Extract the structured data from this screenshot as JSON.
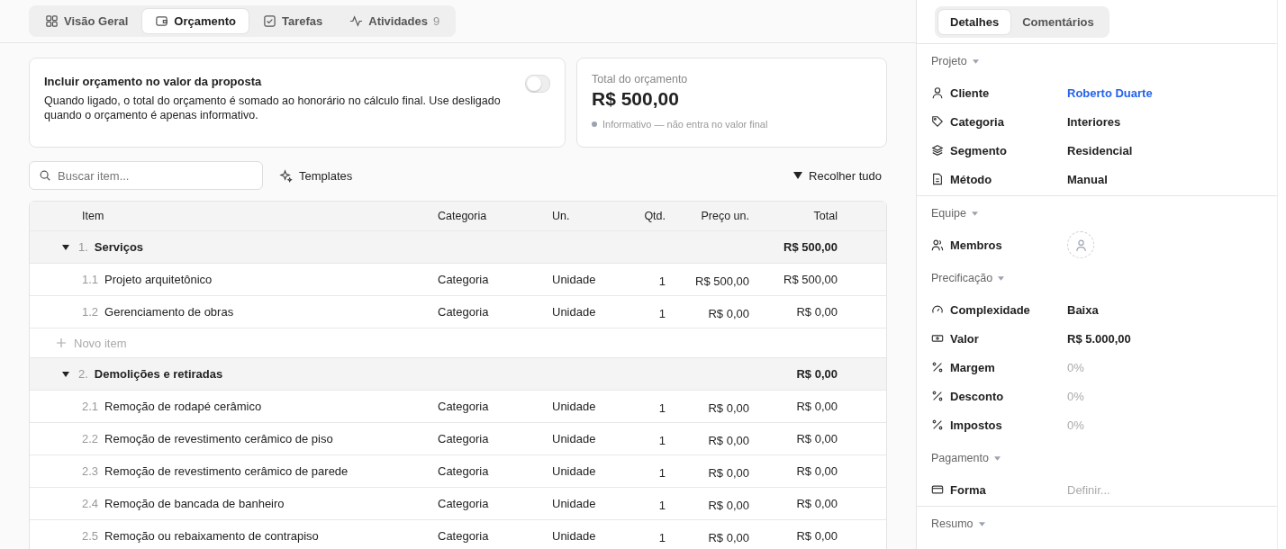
{
  "tabs": [
    {
      "label": "Visão Geral",
      "selected": false
    },
    {
      "label": "Orçamento",
      "selected": true
    },
    {
      "label": "Tarefas",
      "selected": false
    },
    {
      "label": "Atividades",
      "count": "9",
      "selected": false
    }
  ],
  "include_card": {
    "title": "Incluir orçamento no valor da proposta",
    "description": "Quando ligado, o total do orçamento é somado ao honorário no cálculo final. Use desligado quando o orçamento é apenas informativo.",
    "on": false
  },
  "total_card": {
    "label": "Total do orçamento",
    "value": "R$ 500,00",
    "note": "Informativo — não entra no valor final"
  },
  "toolbar": {
    "search": {
      "placeholder": "Buscar item..."
    },
    "templates": "Templates",
    "collapse": "Recolher tudo"
  },
  "table": {
    "columns": [
      "Item",
      "Categoria",
      "Un.",
      "Qtd.",
      "Preço un.",
      "Total"
    ],
    "groups": [
      {
        "number": "1.",
        "name": "Serviços",
        "total": "R$ 500,00",
        "expanded": true,
        "add_label": "Novo item",
        "children": [
          {
            "number": "1.1",
            "name": "Projeto arquitetônico",
            "category": "Categoria",
            "unit": "Unidade",
            "qty": "1",
            "price": "R$ 500,00",
            "total": "R$ 500,00"
          },
          {
            "number": "1.2",
            "name": "Gerenciamento de obras",
            "category": "Categoria",
            "unit": "Unidade",
            "qty": "1",
            "price": "R$ 0,00",
            "total": "R$ 0,00"
          }
        ]
      },
      {
        "number": "2.",
        "name": "Demolições e retiradas",
        "total": "R$ 0,00",
        "expanded": true,
        "children": [
          {
            "number": "2.1",
            "name": "Remoção de rodapé cerâmico",
            "category": "Categoria",
            "unit": "Unidade",
            "qty": "1",
            "price": "R$ 0,00",
            "total": "R$ 0,00"
          },
          {
            "number": "2.2",
            "name": "Remoção de revestimento cerâmico de piso",
            "category": "Categoria",
            "unit": "Unidade",
            "qty": "1",
            "price": "R$ 0,00",
            "total": "R$ 0,00"
          },
          {
            "number": "2.3",
            "name": "Remoção de revestimento cerâmico de parede",
            "category": "Categoria",
            "unit": "Unidade",
            "qty": "1",
            "price": "R$ 0,00",
            "total": "R$ 0,00"
          },
          {
            "number": "2.4",
            "name": "Remoção de bancada de banheiro",
            "category": "Categoria",
            "unit": "Unidade",
            "qty": "1",
            "price": "R$ 0,00",
            "total": "R$ 0,00"
          },
          {
            "number": "2.5",
            "name": "Remoção ou rebaixamento de contrapiso",
            "category": "Categoria",
            "unit": "Unidade",
            "qty": "1",
            "price": "R$ 0,00",
            "total": "R$ 0,00"
          }
        ]
      }
    ]
  },
  "sidebar": {
    "tabs": [
      {
        "label": "Detalhes",
        "selected": true
      },
      {
        "label": "Comentários",
        "selected": false
      }
    ],
    "sections": [
      {
        "title": "Projeto",
        "divider": true,
        "rows": [
          {
            "label": "Cliente",
            "kind": "link",
            "value": "Roberto Duarte"
          },
          {
            "label": "Categoria",
            "kind": "text",
            "value": "Interiores"
          },
          {
            "label": "Segmento",
            "kind": "text",
            "value": "Residencial"
          },
          {
            "label": "Método",
            "kind": "text",
            "value": "Manual"
          }
        ]
      },
      {
        "title": "Equipe",
        "divider": false,
        "rows": [
          {
            "label": "Membros",
            "kind": "avatar"
          }
        ]
      },
      {
        "title": "Precificação",
        "divider": false,
        "rows": [
          {
            "label": "Complexidade",
            "kind": "text",
            "value": "Baixa"
          },
          {
            "label": "Valor",
            "kind": "text",
            "value": "R$ 5.000,00"
          },
          {
            "label": "Margem",
            "kind": "empty",
            "placeholder": "0%"
          },
          {
            "label": "Desconto",
            "kind": "empty",
            "placeholder": "0%"
          },
          {
            "label": "Impostos",
            "kind": "empty",
            "placeholder": "0%"
          }
        ]
      },
      {
        "title": "Pagamento",
        "divider": true,
        "rows": [
          {
            "label": "Forma",
            "kind": "empty",
            "placeholder": "Definir..."
          }
        ]
      },
      {
        "title": "Resumo",
        "divider": false
      }
    ]
  }
}
